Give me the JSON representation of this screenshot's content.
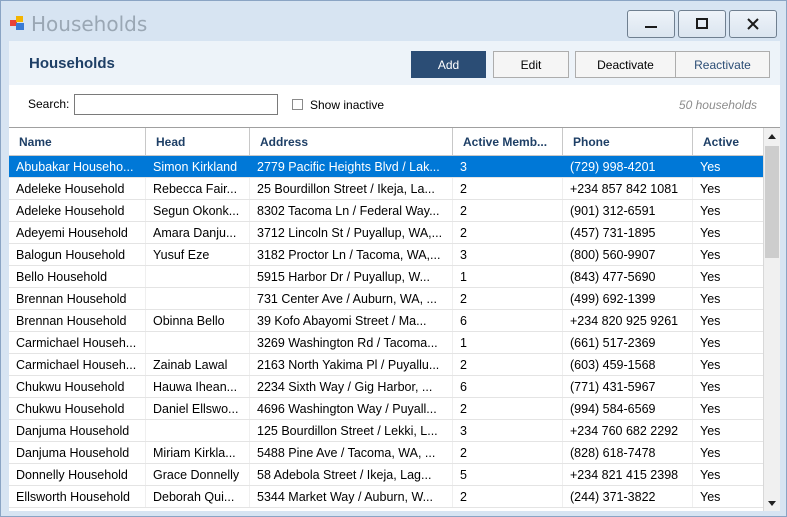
{
  "window": {
    "title": "Households"
  },
  "header": {
    "title": "Households",
    "add_label": "Add",
    "edit_label": "Edit",
    "deactivate_label": "Deactivate",
    "reactivate_label": "Reactivate"
  },
  "filters": {
    "search_label": "Search:",
    "search_value": "",
    "show_inactive_label": "Show inactive",
    "show_inactive_checked": false,
    "count_text": "50 households"
  },
  "colors": {
    "accent": "#2b4d75",
    "selection": "#0078d7",
    "header_text": "#1e3f66"
  },
  "grid": {
    "columns": [
      "Name",
      "Head",
      "Address",
      "Active Memb...",
      "Phone",
      "Active"
    ],
    "selected_row": 0,
    "rows": [
      [
        "Abubakar Househo...",
        "Simon Kirkland",
        "2779 Pacific Heights Blvd / Lak...",
        "3",
        "(729) 998-4201",
        "Yes"
      ],
      [
        "Adeleke Household",
        "Rebecca Fair...",
        "25 Bourdillon Street / Ikeja, La...",
        "2",
        "+234 857 842 1081",
        "Yes"
      ],
      [
        "Adeleke Household",
        "Segun Okonk...",
        "8302 Tacoma Ln / Federal Way...",
        "2",
        "(901) 312-6591",
        "Yes"
      ],
      [
        "Adeyemi Household",
        "Amara Danju...",
        "3712 Lincoln St / Puyallup, WA,...",
        "2",
        "(457) 731-1895",
        "Yes"
      ],
      [
        "Balogun Household",
        "Yusuf Eze",
        "3182 Proctor Ln / Tacoma, WA,...",
        "3",
        "(800) 560-9907",
        "Yes"
      ],
      [
        "Bello Household",
        "",
        "5915 Harbor Dr / Puyallup, W...",
        "1",
        "(843) 477-5690",
        "Yes"
      ],
      [
        "Brennan Household",
        "",
        "731 Center Ave / Auburn, WA, ...",
        "2",
        "(499) 692-1399",
        "Yes"
      ],
      [
        "Brennan Household",
        "Obinna Bello",
        "39 Kofo Abayomi Street / Ma...",
        "6",
        "+234 820 925 9261",
        "Yes"
      ],
      [
        "Carmichael Househ...",
        "",
        "3269 Washington Rd / Tacoma...",
        "1",
        "(661) 517-2369",
        "Yes"
      ],
      [
        "Carmichael Househ...",
        "Zainab Lawal",
        "2163 North Yakima Pl / Puyallu...",
        "2",
        "(603) 459-1568",
        "Yes"
      ],
      [
        "Chukwu Household",
        "Hauwa Ihean...",
        "2234 Sixth Way / Gig Harbor, ...",
        "6",
        "(771) 431-5967",
        "Yes"
      ],
      [
        "Chukwu Household",
        "Daniel Ellswo...",
        "4696 Washington Way / Puyall...",
        "2",
        "(994) 584-6569",
        "Yes"
      ],
      [
        "Danjuma Household",
        "",
        "125 Bourdillon Street / Lekki, L...",
        "3",
        "+234 760 682 2292",
        "Yes"
      ],
      [
        "Danjuma Household",
        "Miriam Kirkla...",
        "5488 Pine Ave / Tacoma, WA, ...",
        "2",
        "(828) 618-7478",
        "Yes"
      ],
      [
        "Donnelly Household",
        "Grace Donnelly",
        "58 Adebola Street / Ikeja, Lag...",
        "5",
        "+234 821 415 2398",
        "Yes"
      ],
      [
        "Ellsworth Household",
        "Deborah Qui...",
        "5344 Market Way / Auburn, W...",
        "2",
        "(244) 371-3822",
        "Yes"
      ]
    ]
  }
}
